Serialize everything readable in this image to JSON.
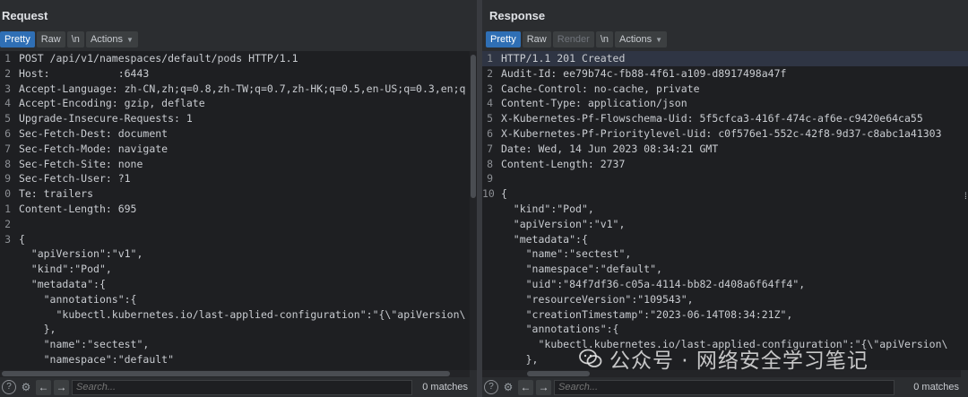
{
  "request": {
    "title": "Request",
    "tabs": [
      "Pretty",
      "Raw",
      "\\n",
      "Actions"
    ],
    "lines": [
      {
        "n": "1",
        "t": "POST /api/v1/namespaces/default/pods HTTP/1.1"
      },
      {
        "n": "2",
        "t": "Host:           :6443"
      },
      {
        "n": "3",
        "t": "Accept-Language: zh-CN,zh;q=0.8,zh-TW;q=0.7,zh-HK;q=0.5,en-US;q=0.3,en;q"
      },
      {
        "n": "4",
        "t": "Accept-Encoding: gzip, deflate"
      },
      {
        "n": "5",
        "t": "Upgrade-Insecure-Requests: 1"
      },
      {
        "n": "6",
        "t": "Sec-Fetch-Dest: document"
      },
      {
        "n": "7",
        "t": "Sec-Fetch-Mode: navigate"
      },
      {
        "n": "8",
        "t": "Sec-Fetch-Site: none"
      },
      {
        "n": "9",
        "t": "Sec-Fetch-User: ?1"
      },
      {
        "n": "0",
        "t": "Te: trailers"
      },
      {
        "n": "1",
        "t": "Content-Length: 695"
      },
      {
        "n": "2",
        "t": ""
      },
      {
        "n": "3",
        "t": "{"
      },
      {
        "n": "",
        "t": "  \"apiVersion\":\"v1\","
      },
      {
        "n": "",
        "t": "  \"kind\":\"Pod\","
      },
      {
        "n": "",
        "t": "  \"metadata\":{"
      },
      {
        "n": "",
        "t": "    \"annotations\":{"
      },
      {
        "n": "",
        "t": "      \"kubectl.kubernetes.io/last-applied-configuration\":\"{\\\"apiVersion\\"
      },
      {
        "n": "",
        "t": "    },"
      },
      {
        "n": "",
        "t": "    \"name\":\"sectest\","
      },
      {
        "n": "",
        "t": "    \"namespace\":\"default\""
      }
    ],
    "search_placeholder": "Search...",
    "matches": "0 matches"
  },
  "response": {
    "title": "Response",
    "tabs": [
      "Pretty",
      "Raw",
      "Render",
      "\\n",
      "Actions"
    ],
    "lines": [
      {
        "n": "1",
        "t": "HTTP/1.1 201 Created"
      },
      {
        "n": "2",
        "t": "Audit-Id: ee79b74c-fb88-4f61-a109-d8917498a47f"
      },
      {
        "n": "3",
        "t": "Cache-Control: no-cache, private"
      },
      {
        "n": "4",
        "t": "Content-Type: application/json"
      },
      {
        "n": "5",
        "t": "X-Kubernetes-Pf-Flowschema-Uid: 5f5cfca3-416f-474c-af6e-c9420e64ca55"
      },
      {
        "n": "6",
        "t": "X-Kubernetes-Pf-Prioritylevel-Uid: c0f576e1-552c-42f8-9d37-c8abc1a41303"
      },
      {
        "n": "7",
        "t": "Date: Wed, 14 Jun 2023 08:34:21 GMT"
      },
      {
        "n": "8",
        "t": "Content-Length: 2737"
      },
      {
        "n": "9",
        "t": ""
      },
      {
        "n": "10",
        "t": "{"
      },
      {
        "n": "",
        "t": "  \"kind\":\"Pod\","
      },
      {
        "n": "",
        "t": "  \"apiVersion\":\"v1\","
      },
      {
        "n": "",
        "t": "  \"metadata\":{"
      },
      {
        "n": "",
        "t": "    \"name\":\"sectest\","
      },
      {
        "n": "",
        "t": "    \"namespace\":\"default\","
      },
      {
        "n": "",
        "t": "    \"uid\":\"84f7df36-c05a-4114-bb82-d408a6f64ff4\","
      },
      {
        "n": "",
        "t": "    \"resourceVersion\":\"109543\","
      },
      {
        "n": "",
        "t": "    \"creationTimestamp\":\"2023-06-14T08:34:21Z\","
      },
      {
        "n": "",
        "t": "    \"annotations\":{"
      },
      {
        "n": "",
        "t": "      \"kubectl.kubernetes.io/last-applied-configuration\":\"{\\\"apiVersion\\"
      },
      {
        "n": "",
        "t": "    },"
      }
    ],
    "search_placeholder": "Search...",
    "matches": "0 matches"
  },
  "watermark": "公众号 · 网络安全学习笔记",
  "icons": {
    "help": "help-icon",
    "settings": "gear-icon",
    "prev": "arrow-left-icon",
    "next": "arrow-right-icon",
    "layout_split": "split-view-icon",
    "layout_horizontal": "horizontal-view-icon",
    "layout_vertical": "vertical-view-icon"
  },
  "colors": {
    "active_tab": "#2f6fb5",
    "editor_bg": "#1e1f22",
    "panel_bg": "#2b2d30"
  }
}
